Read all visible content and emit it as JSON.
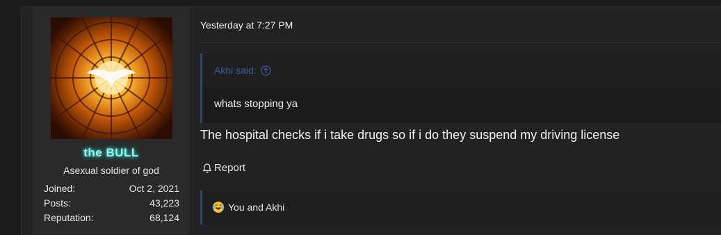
{
  "post": {
    "author": {
      "username": "the BULL",
      "title": "Asexual soldier of god",
      "avatar_icon": "dove-stained-glass-avatar",
      "stats": [
        {
          "label": "Joined:",
          "value": "Oct 2, 2021"
        },
        {
          "label": "Posts:",
          "value": "43,223"
        },
        {
          "label": "Reputation:",
          "value": "68,124"
        }
      ]
    },
    "timestamp": "Yesterday at 7:27 PM",
    "quote": {
      "attribution": "Akhi said:",
      "text": "whats stopping ya"
    },
    "message": "The hospital checks if i take drugs so if i do they suspend my driving license",
    "actions": {
      "report_label": "Report"
    },
    "reactions": {
      "summary": "You and Akhi",
      "icon": "laughing-crying-emoji"
    }
  },
  "colors": {
    "username_glow": "#33d6c8",
    "quote_accent": "#2f4470",
    "quote_link": "#3d5a9e"
  }
}
